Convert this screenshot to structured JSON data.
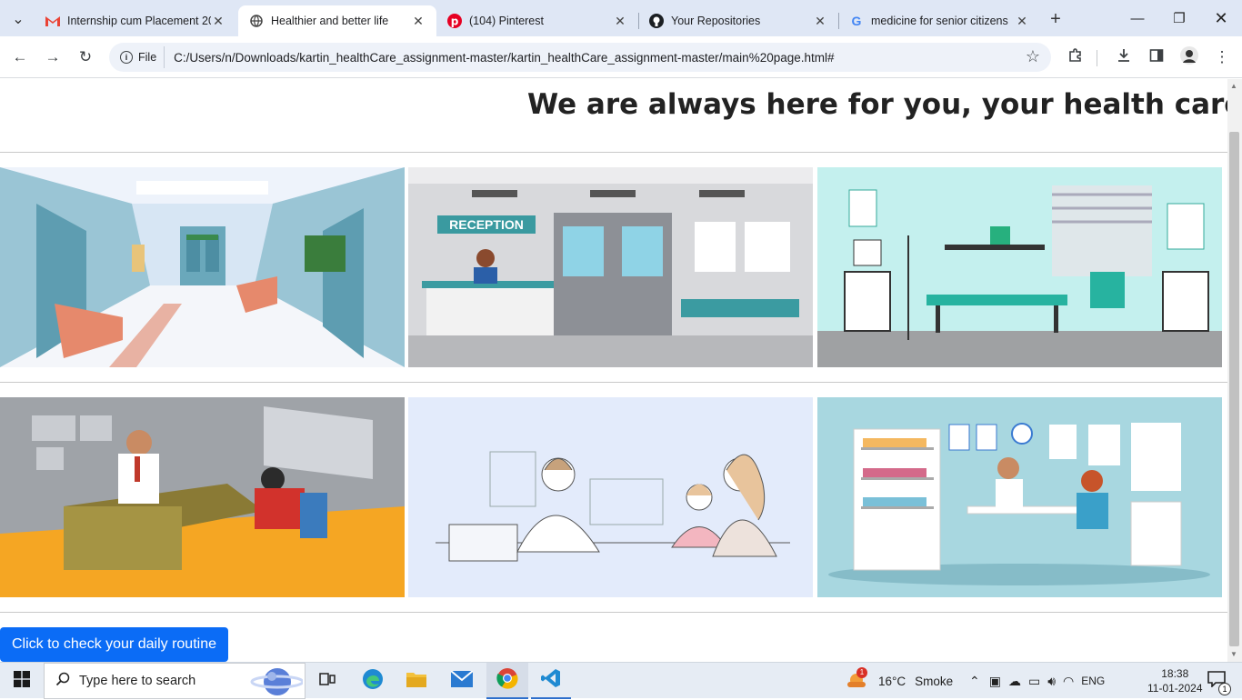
{
  "browser": {
    "tabs": [
      {
        "title": "Internship cum Placement 20",
        "icon": "gmail-icon"
      },
      {
        "title": "Healthier and better life",
        "icon": "globe-icon"
      },
      {
        "title": "(104) Pinterest",
        "icon": "pinterest-icon"
      },
      {
        "title": "Your Repositories",
        "icon": "github-icon"
      },
      {
        "title": "medicine for senior citizens",
        "icon": "google-icon"
      }
    ],
    "site_chip": "File",
    "url": "C:/Users/n/Downloads/kartin_healthCare_assignment-master/kartin_healthCare_assignment-master/main%20page.html#"
  },
  "page": {
    "heading": "We are always here for you, your health care and your",
    "images": [
      {
        "name": "hospital-corridor-image"
      },
      {
        "name": "reception-desk-image"
      },
      {
        "name": "patient-ward-image"
      },
      {
        "name": "doctor-consultation-image"
      },
      {
        "name": "doctor-mother-child-image"
      },
      {
        "name": "clinic-office-image"
      }
    ],
    "cta_label": "Click to check your daily routine"
  },
  "taskbar": {
    "search_placeholder": "Type here to search",
    "weather_temp": "16°C",
    "weather_text": "Smoke",
    "weather_badge": "1",
    "language": "ENG",
    "time": "18:38",
    "date": "11-01-2024",
    "notification_count": "1"
  }
}
